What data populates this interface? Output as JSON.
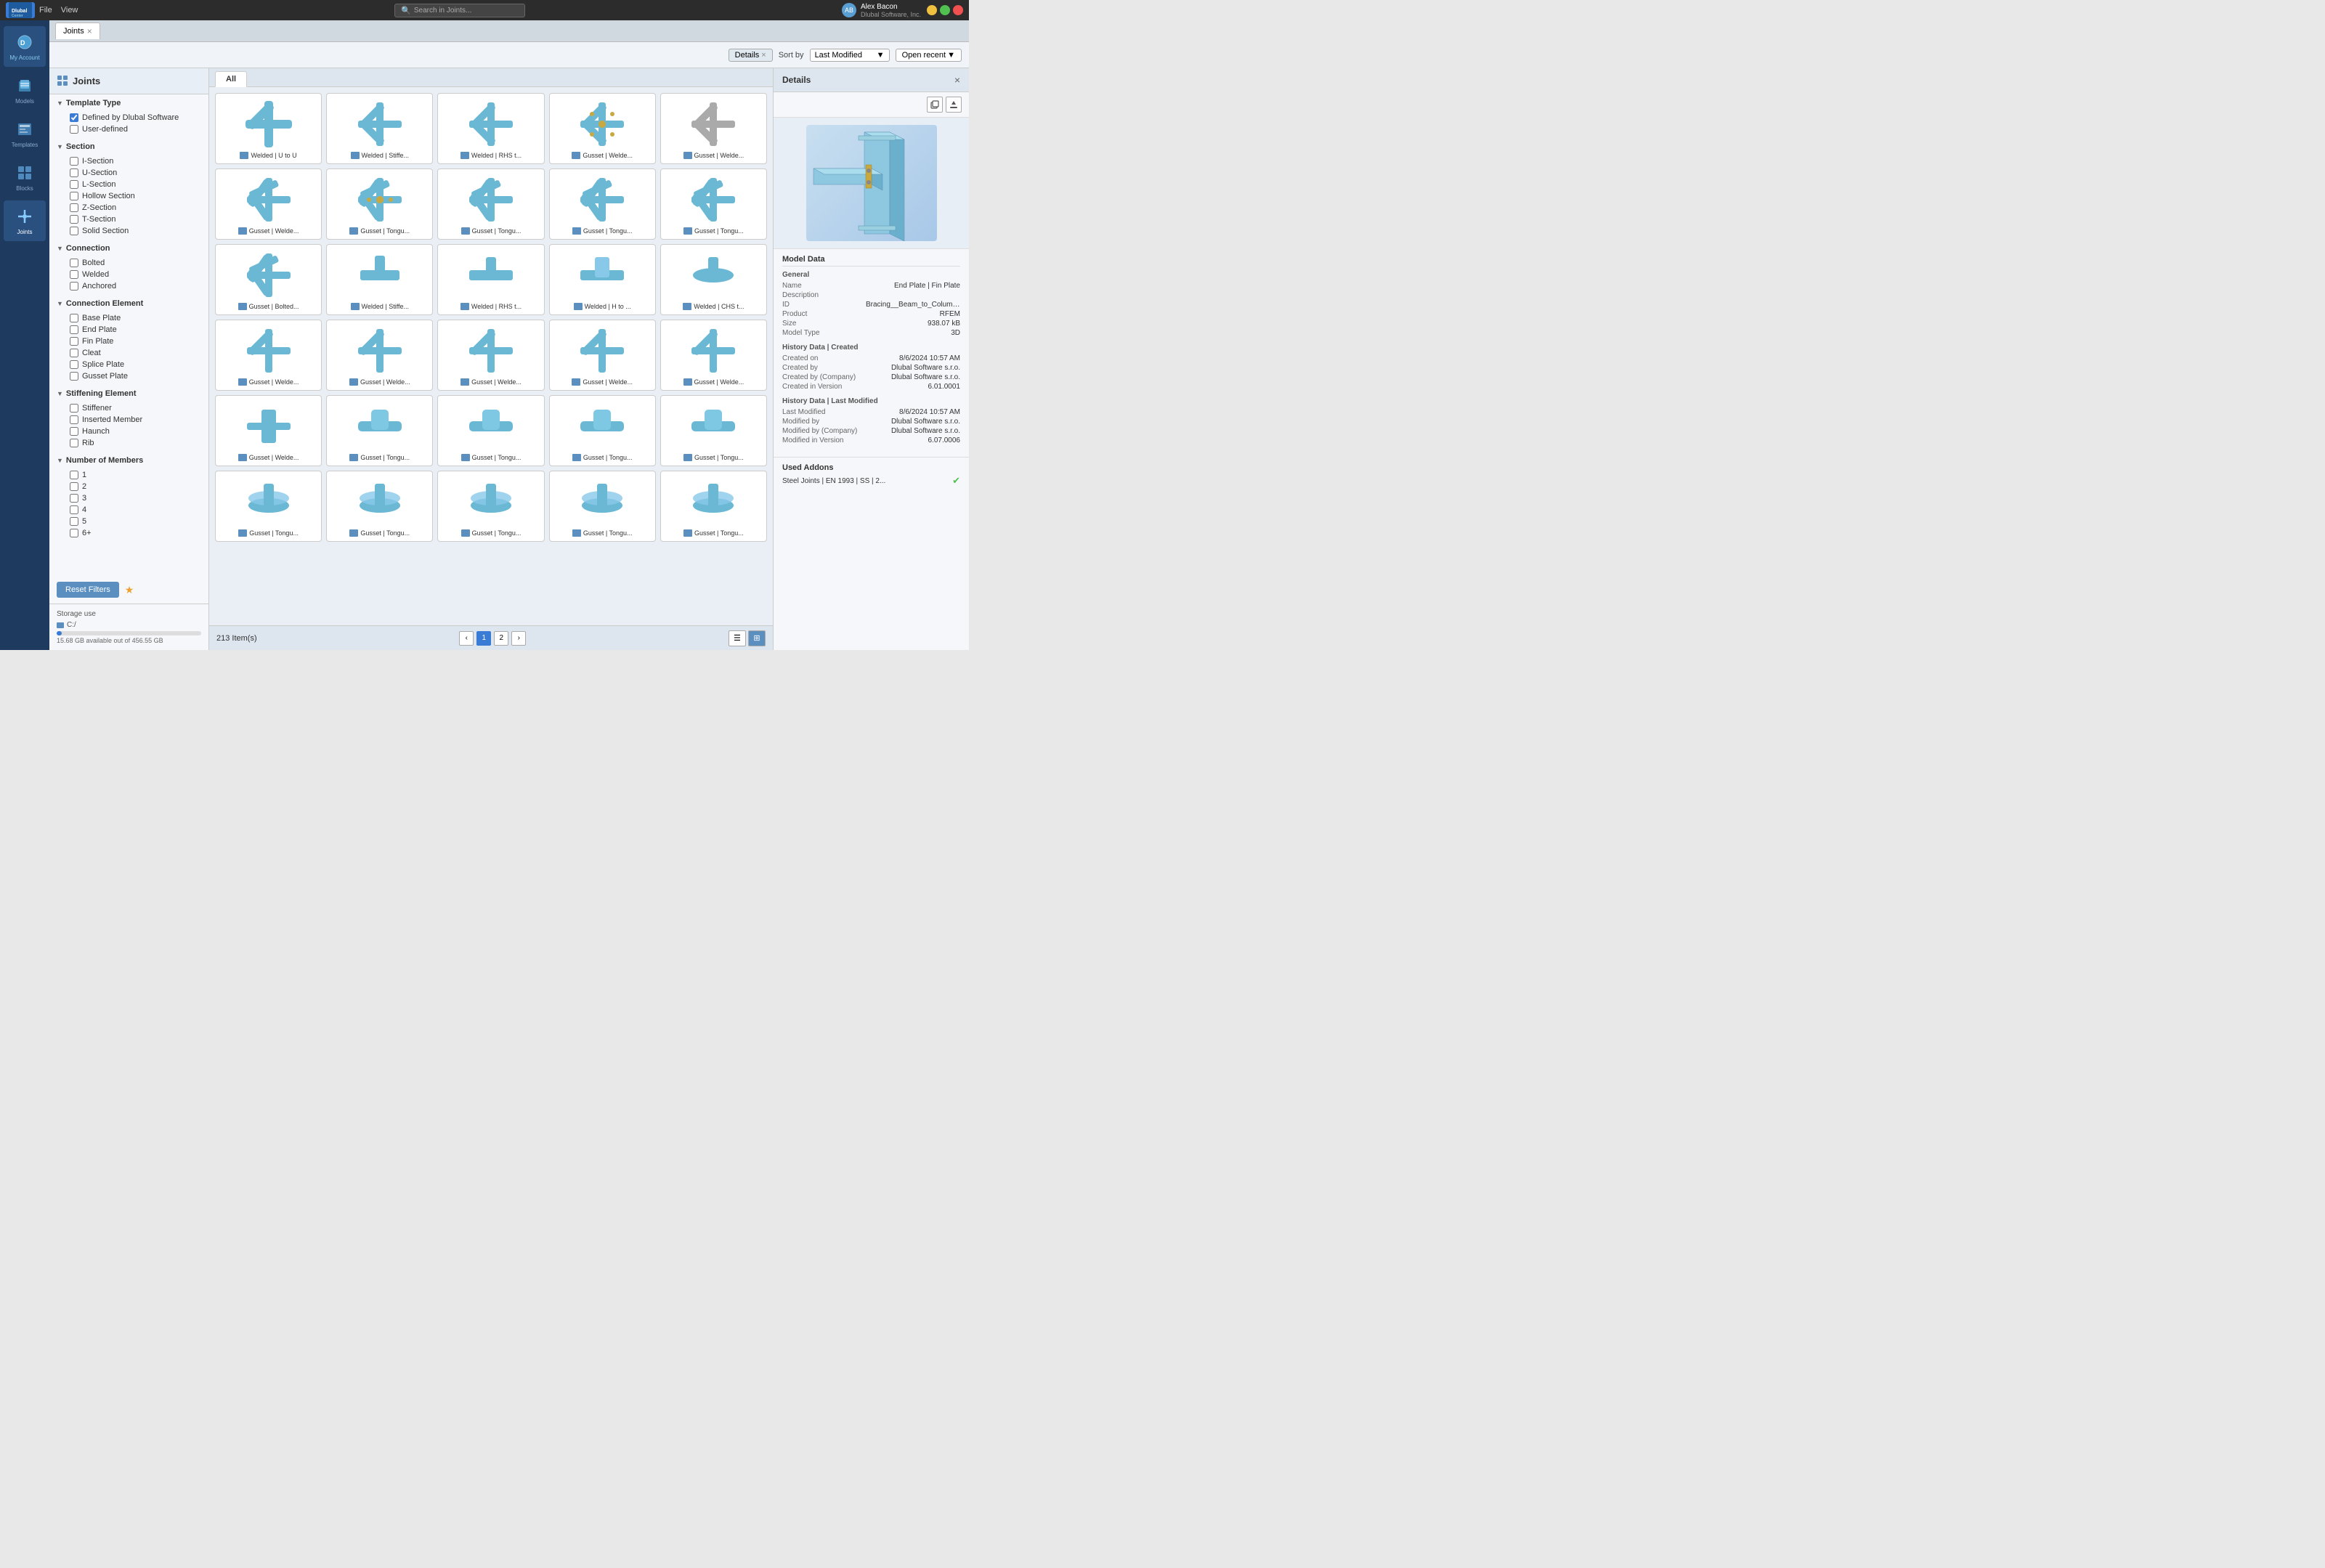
{
  "titleBar": {
    "appName": "Dlubal Center",
    "menus": [
      "File",
      "View"
    ],
    "searchPlaceholder": "Search in Joints...",
    "user": {
      "name": "Alex Bacon",
      "company": "Dlubal Software, Inc."
    }
  },
  "tabs": [
    {
      "label": "Joints",
      "active": true
    }
  ],
  "toolbar": {
    "detailsLabel": "Details",
    "sortLabel": "Sort by",
    "sortValue": "Last Modified",
    "openRecentLabel": "Open recent"
  },
  "filters": {
    "title": "Joints",
    "sections": [
      {
        "label": "Template Type",
        "expanded": true,
        "items": [
          {
            "label": "Defined by Dlubal Software",
            "checked": true
          },
          {
            "label": "User-defined",
            "checked": false
          }
        ]
      },
      {
        "label": "Section",
        "expanded": true,
        "items": [
          {
            "label": "I-Section",
            "checked": false
          },
          {
            "label": "U-Section",
            "checked": false
          },
          {
            "label": "L-Section",
            "checked": false
          },
          {
            "label": "Hollow Section",
            "checked": false
          },
          {
            "label": "Z-Section",
            "checked": false
          },
          {
            "label": "T-Section",
            "checked": false
          },
          {
            "label": "Solid Section",
            "checked": false
          }
        ]
      },
      {
        "label": "Connection",
        "expanded": true,
        "items": [
          {
            "label": "Bolted",
            "checked": false
          },
          {
            "label": "Welded",
            "checked": false
          },
          {
            "label": "Anchored",
            "checked": false
          }
        ]
      },
      {
        "label": "Connection Element",
        "expanded": true,
        "items": [
          {
            "label": "Base Plate",
            "checked": false
          },
          {
            "label": "End Plate",
            "checked": false
          },
          {
            "label": "Fin Plate",
            "checked": false
          },
          {
            "label": "Cleat",
            "checked": false
          },
          {
            "label": "Splice Plate",
            "checked": false
          },
          {
            "label": "Gusset Plate",
            "checked": false
          }
        ]
      },
      {
        "label": "Stiffening Element",
        "expanded": true,
        "items": [
          {
            "label": "Stiffener",
            "checked": false
          },
          {
            "label": "Inserted Member",
            "checked": false
          },
          {
            "label": "Haunch",
            "checked": false
          },
          {
            "label": "Rib",
            "checked": false
          }
        ]
      },
      {
        "label": "Number of Members",
        "expanded": true,
        "items": [
          {
            "label": "1",
            "checked": false
          },
          {
            "label": "2",
            "checked": false
          },
          {
            "label": "3",
            "checked": false
          },
          {
            "label": "4",
            "checked": false
          },
          {
            "label": "5",
            "checked": false
          },
          {
            "label": "6+",
            "checked": false
          }
        ]
      }
    ],
    "resetLabel": "Reset Filters",
    "storage": {
      "title": "Storage use",
      "drive": "C:/",
      "used": "15.68 GB available out of 456.55 GB",
      "percent": 3.4
    }
  },
  "gridTabs": [
    {
      "label": "All",
      "active": true
    }
  ],
  "gridItems": [
    {
      "label": "Welded | U to U",
      "type": "cross4",
      "color": "#6bb8d4"
    },
    {
      "label": "Welded | Stiffe...",
      "type": "cross4",
      "color": "#6bb8d4"
    },
    {
      "label": "Welded | RHS t...",
      "type": "cross4",
      "color": "#6bb8d4"
    },
    {
      "label": "Gusset | Welde...",
      "type": "cross4bolt",
      "color": "#6bb8d4"
    },
    {
      "label": "Gusset | Welde...",
      "type": "cross4",
      "color": "#aaa"
    },
    {
      "label": "Gusset | Welde...",
      "type": "cross5",
      "color": "#6bb8d4"
    },
    {
      "label": "Gusset | Tongu...",
      "type": "cross5bolt",
      "color": "#c8a840"
    },
    {
      "label": "Gusset | Tongu...",
      "type": "cross5",
      "color": "#6bb8d4"
    },
    {
      "label": "Gusset | Tongu...",
      "type": "cross5",
      "color": "#6bb8d4"
    },
    {
      "label": "Gusset | Tongu...",
      "type": "cross5",
      "color": "#6bb8d4"
    },
    {
      "label": "Gusset | Bolted...",
      "type": "cross5",
      "color": "#6bb8d4"
    },
    {
      "label": "Welded | Stiffe...",
      "type": "beam",
      "color": "#6bb8d4"
    },
    {
      "label": "Welded | RHS t...",
      "type": "beam",
      "color": "#6bb8d4"
    },
    {
      "label": "Welded | H to ...",
      "type": "Tshaped",
      "color": "#6bb8d4"
    },
    {
      "label": "Welded | CHS t...",
      "type": "pipe",
      "color": "#6bb8d4"
    },
    {
      "label": "Gusset | Welde...",
      "type": "cross4",
      "color": "#6bb8d4"
    },
    {
      "label": "Gusset | Welde...",
      "type": "cross4",
      "color": "#6bb8d4"
    },
    {
      "label": "Gusset | Welde...",
      "type": "cross4",
      "color": "#6bb8d4"
    },
    {
      "label": "Gusset | Welde...",
      "type": "cross4",
      "color": "#6bb8d4"
    },
    {
      "label": "Gusset | Welde...",
      "type": "cross4",
      "color": "#6bb8d4"
    },
    {
      "label": "Gusset | Welde...",
      "type": "beam2",
      "color": "#6bb8d4"
    },
    {
      "label": "Gusset | Tongu...",
      "type": "pipe2",
      "color": "#6bb8d4"
    },
    {
      "label": "Gusset | Tongu...",
      "type": "pipe2",
      "color": "#6bb8d4"
    },
    {
      "label": "Gusset | Tongu...",
      "type": "pipe2",
      "color": "#6bb8d4"
    },
    {
      "label": "Gusset | Tongu...",
      "type": "pipe2",
      "color": "#6bb8d4"
    },
    {
      "label": "Gusset | Tongu...",
      "type": "pipe3",
      "color": "#6bb8d4"
    },
    {
      "label": "Gusset | Tongu...",
      "type": "pipe3",
      "color": "#6bb8d4"
    },
    {
      "label": "Gusset | Tongu...",
      "type": "pipe3",
      "color": "#6bb8d4"
    },
    {
      "label": "Gusset | Tongu...",
      "type": "pipe3",
      "color": "#6bb8d4"
    },
    {
      "label": "Gusset | Tongu...",
      "type": "pipe3",
      "color": "#6bb8d4"
    }
  ],
  "itemsCount": "213 Item(s)",
  "pagination": {
    "pages": [
      1,
      2
    ],
    "activePage": 1
  },
  "details": {
    "title": "Details",
    "modelData": {
      "title": "Model Data",
      "general": {
        "title": "General",
        "name": "End Plate | Fin Plate",
        "description": "",
        "id": "Bracing__Beam_to_Column_End_Pl...",
        "product": "RFEM",
        "size": "938.07 kB",
        "modelType": "3D"
      },
      "historyCreated": {
        "title": "History Data | Created",
        "createdOn": "8/6/2024 10:57 AM",
        "createdBy": "Dlubal Software s.r.o.",
        "createdByCompany": "Dlubal Software s.r.o.",
        "createdInVersion": "6.01.0001"
      },
      "historyModified": {
        "title": "History Data | Last Modified",
        "lastModified": "8/6/2024 10:57 AM",
        "modifiedBy": "Dlubal Software s.r.o.",
        "modifiedByCompany": "Dlubal Software s.r.o.",
        "modifiedInVersion": "6.07.0006"
      }
    },
    "usedAddons": {
      "title": "Used Addons",
      "items": [
        {
          "label": "Steel Joints | EN 1993 | SS | 2...",
          "active": true
        }
      ]
    }
  }
}
